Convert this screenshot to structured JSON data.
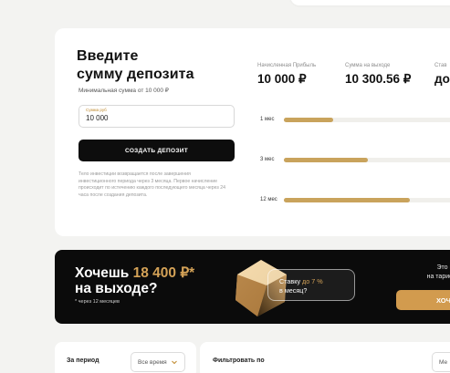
{
  "deposit": {
    "title": "Введите\nсумму депозита",
    "min_amount": "Минимальная сумма от 10 000 ₽",
    "amount_label": "Сумма руб",
    "amount_value": "10 000",
    "create_button": "СОЗДАТЬ ДЕПОЗИТ",
    "terms": "Тело инвестиции возвращается после завершения инвестиционного периода через 3 месяца. Первое начисление происходит по истечению каждого последующего месяца через 24 часа после создания депозита."
  },
  "stats": [
    {
      "label": "Начисленная Прибыль",
      "value": "10 000 ₽"
    },
    {
      "label": "Сумма на выходе",
      "value": "10 300.56 ₽"
    },
    {
      "label": "Став",
      "value": "до"
    }
  ],
  "chart_data": {
    "type": "bar",
    "orientation": "horizontal",
    "categories": [
      "1 мес",
      "3 мес",
      "12 мес"
    ],
    "values": [
      0.27,
      0.46,
      0.69
    ]
  },
  "promo": {
    "title_prefix": "Хочешь",
    "title_amount": "18 400 ₽*",
    "title_suffix": "на выходе?",
    "note": "* через 12 месяцев",
    "rate_prefix": "Ставку",
    "rate_value": "до 7 %",
    "rate_suffix": "в месяц?",
    "right_line1": "Это возм",
    "right_line2": "на тарифе Z",
    "button": "ХОЧ"
  },
  "period": {
    "label": "За период",
    "select_value": "Все время"
  },
  "filter": {
    "label": "Фильтровать по",
    "select_value": "Ме"
  },
  "colors": {
    "accent": "#c08a2e",
    "bar": "#c9a35c",
    "promo_bg": "#0b0b0b",
    "button_gold": "#d29b4e"
  },
  "icons": {
    "period_select": "chevron-down-icon",
    "promo_art": "gem-icon"
  }
}
